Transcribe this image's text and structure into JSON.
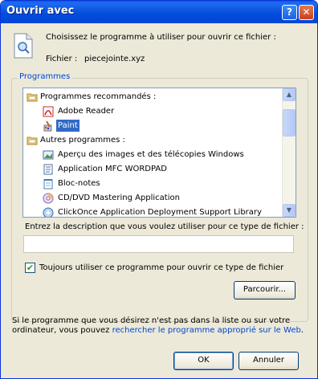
{
  "window": {
    "title": "Ouvrir avec",
    "help_label": "?",
    "close_label": "✕"
  },
  "header": {
    "instruction": "Choisissez le programme à utiliser pour ouvrir ce fichier :",
    "file_label": "Fichier :",
    "file_name": "piecejointe.xyz"
  },
  "programs": {
    "group_label": "Programmes",
    "items": [
      {
        "label": "Programmes recommandés :",
        "type": "category",
        "icon": "folder-icon"
      },
      {
        "label": "Adobe Reader",
        "type": "program",
        "icon": "adobe-reader-icon"
      },
      {
        "label": "Paint",
        "type": "program",
        "icon": "paint-icon",
        "selected": true
      },
      {
        "label": "Autres programmes :",
        "type": "category",
        "icon": "folder-icon"
      },
      {
        "label": "Aperçu des images et des télécopies Windows",
        "type": "program",
        "icon": "image-viewer-icon"
      },
      {
        "label": "Application MFC WORDPAD",
        "type": "program",
        "icon": "wordpad-icon"
      },
      {
        "label": "Bloc-notes",
        "type": "program",
        "icon": "notepad-icon"
      },
      {
        "label": "CD/DVD Mastering Application",
        "type": "program",
        "icon": "cd-dvd-icon"
      },
      {
        "label": "ClickOnce Application Deployment Support Library",
        "type": "program",
        "icon": "clickonce-icon"
      }
    ]
  },
  "description": {
    "label": "Entrez la description que vous voulez utiliser pour ce type de fichier :",
    "value": ""
  },
  "always_use": {
    "label": "Toujours utiliser ce programme pour ouvrir ce type de fichier",
    "checked": true
  },
  "browse_label": "Parcourir...",
  "footer": {
    "text_line1": "Si le programme que vous désirez n'est pas dans la liste ou sur votre",
    "text_line2_prefix": "ordinateur, vous pouvez ",
    "link_text": "rechercher le programme approprié sur le Web",
    "text_line2_suffix": "."
  },
  "buttons": {
    "ok": "OK",
    "cancel": "Annuler"
  },
  "colors": {
    "titlebar": "#0a56e0",
    "dialog_bg": "#ece9d8",
    "selection": "#316ac5",
    "link": "#0046d5"
  }
}
